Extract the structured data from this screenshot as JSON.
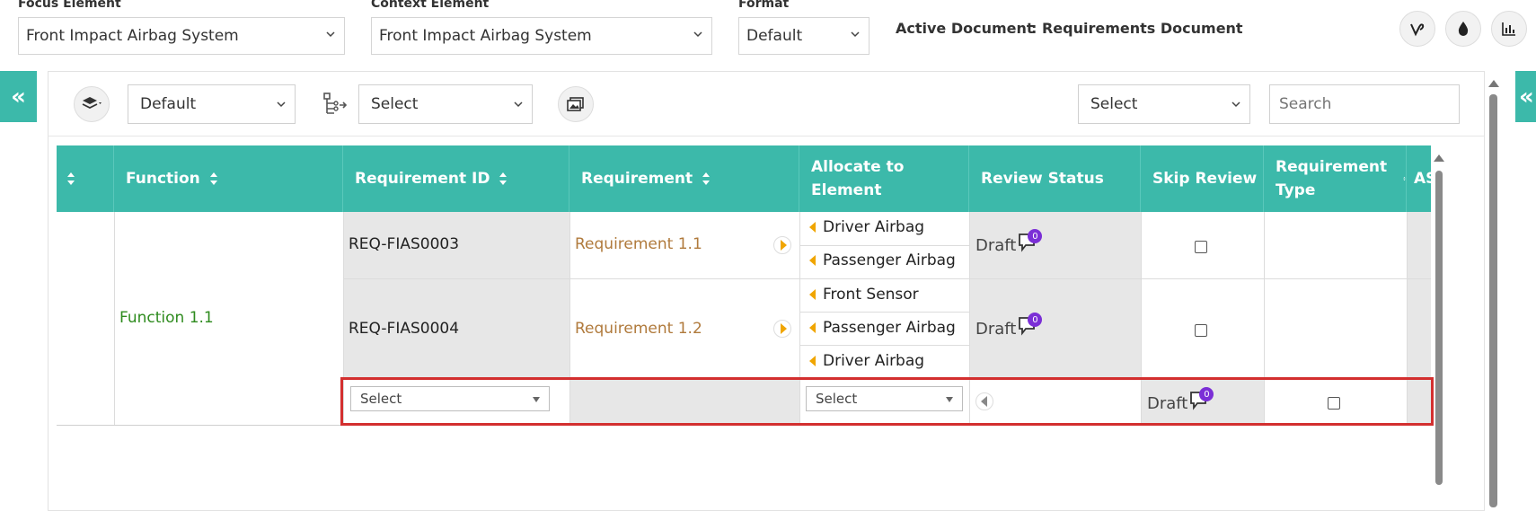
{
  "topbar": {
    "focus_label": "Focus Element",
    "focus_value": "Front Impact Airbag System",
    "context_label": "Context Element",
    "context_value": "Front Impact Airbag System",
    "format_label": "Format",
    "format_value": "Default",
    "active_doc_label": "Active Document",
    "active_doc_value": ": Requirements Document",
    "icons": [
      "vine-icon",
      "drop-icon",
      "bar-chart-icon"
    ]
  },
  "side": {
    "collapse_glyph": "«"
  },
  "toolbar": {
    "view_select": "Default",
    "hierarchy_select": "Select",
    "right_select": "Select",
    "search_placeholder": "Search"
  },
  "table": {
    "headers": {
      "function": "Function",
      "requirement_id": "Requirement ID",
      "requirement": "Requirement",
      "allocate_1": "Allocate to",
      "allocate_2": "Element",
      "review_status": "Review Status",
      "skip_review": "Skip Review",
      "req_type_1": "Requirement",
      "req_type_2": "Type",
      "cut": "AS"
    },
    "function_name": "Function 1.1",
    "rows": [
      {
        "id": "REQ-FIAS0003",
        "requirement": "Requirement 1.1",
        "elements": [
          "Driver Airbag",
          "Passenger Airbag"
        ],
        "status": "Draft",
        "comments": "0"
      },
      {
        "id": "REQ-FIAS0004",
        "requirement": "Requirement 1.2",
        "elements": [
          "Front Sensor",
          "Passenger Airbag",
          "Driver Airbag"
        ],
        "status": "Draft",
        "comments": "0"
      }
    ],
    "new_row": {
      "id_select": "Select",
      "element_select": "Select",
      "status": "Draft",
      "comments": "0"
    }
  },
  "colors": {
    "header_bg": "#3cb9aa",
    "function_text": "#2e8b1e",
    "requirement_text": "#b07a3c",
    "accent_arrow": "#f0a500",
    "badge": "#7b2fd6",
    "highlight": "#d32f2f"
  }
}
